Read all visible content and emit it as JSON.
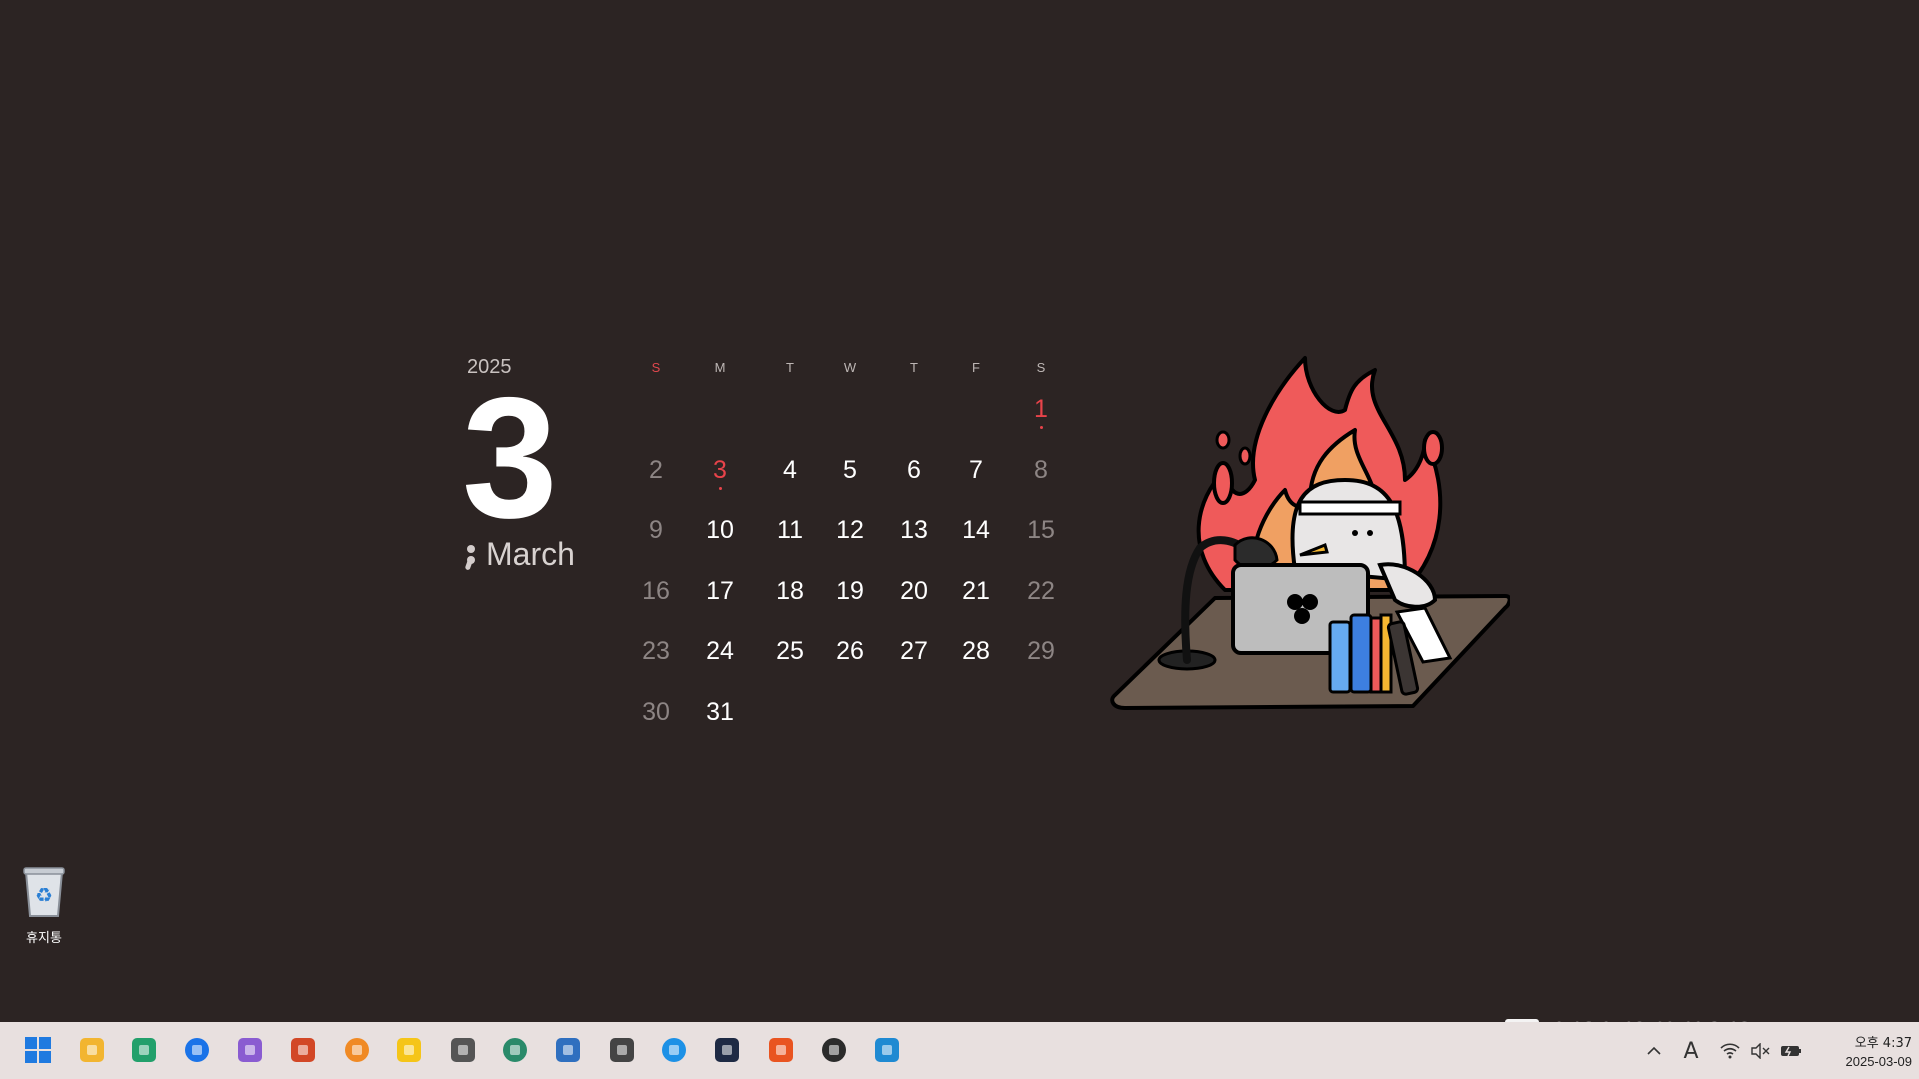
{
  "calendar": {
    "year": "2025",
    "day_big": "3",
    "month": "March",
    "weekdays": [
      "S",
      "M",
      "T",
      "W",
      "T",
      "F",
      "S"
    ],
    "weeks": [
      [
        "",
        "",
        "",
        "",
        "",
        "",
        "1"
      ],
      [
        "2",
        "3",
        "4",
        "5",
        "6",
        "7",
        "8"
      ],
      [
        "9",
        "10",
        "11",
        "12",
        "13",
        "14",
        "15"
      ],
      [
        "16",
        "17",
        "18",
        "19",
        "20",
        "21",
        "22"
      ],
      [
        "23",
        "24",
        "25",
        "26",
        "27",
        "28",
        "29"
      ],
      [
        "30",
        "31",
        "",
        "",
        "",
        "",
        ""
      ]
    ],
    "highlighted_days": [
      "1",
      "3"
    ]
  },
  "desktop": {
    "recycle_bin_label": "휴지통"
  },
  "watermark": {
    "text": "programmers"
  },
  "taskbar": {
    "apps": [
      {
        "name": "start-icon",
        "color": "#1f7ae0"
      },
      {
        "name": "file-explorer-icon",
        "color": "#f2b530"
      },
      {
        "name": "browser-icon",
        "color": "#22a06b"
      },
      {
        "name": "calendar-app-icon",
        "color": "#1a73e8"
      },
      {
        "name": "visual-studio-icon",
        "color": "#8a5cd1"
      },
      {
        "name": "powerpoint-icon",
        "color": "#d24726"
      },
      {
        "name": "network-app-icon",
        "color": "#f08a24"
      },
      {
        "name": "bandizip-icon",
        "color": "#f5c518"
      },
      {
        "name": "clock-app-icon",
        "color": "#555555"
      },
      {
        "name": "vb-app-icon",
        "color": "#2a8a6a"
      },
      {
        "name": "remote-desktop-icon",
        "color": "#2f6fbf"
      },
      {
        "name": "unity-icon",
        "color": "#444444"
      },
      {
        "name": "docker-icon",
        "color": "#1d91e6"
      },
      {
        "name": "powershell-icon",
        "color": "#1e2a44"
      },
      {
        "name": "ubuntu-icon",
        "color": "#e95420"
      },
      {
        "name": "obs-icon",
        "color": "#2b2b2b"
      },
      {
        "name": "vscode-icon",
        "color": "#1f8ad2"
      }
    ],
    "tray": {
      "ime_label": "A"
    },
    "clock": {
      "time": "오후 4:37",
      "date": "2025-03-09"
    }
  },
  "colors": {
    "background": "#2c2423",
    "accent_red": "#e8434a"
  }
}
